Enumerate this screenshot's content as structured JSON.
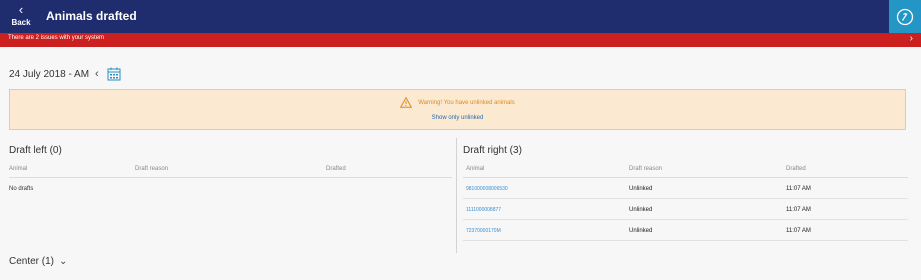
{
  "header": {
    "back_label": "Back",
    "back_icon": "‹",
    "title": "Animals drafted",
    "help_icon": "help-icon"
  },
  "issues": {
    "text": "There are 2 issues with your system",
    "arrow": "›"
  },
  "date": {
    "value": "24 July 2018 - AM",
    "prev_icon": "‹"
  },
  "warning": {
    "text": "Warning! You have unlinked animals",
    "link": "Show only unlinked"
  },
  "draft_left": {
    "title": "Draft left (0)",
    "columns": [
      "Animal",
      "Draft reason",
      "Drafted"
    ],
    "empty": "No drafts"
  },
  "draft_right": {
    "title": "Draft right (3)",
    "columns": [
      "Animal",
      "Draft reason",
      "Drafted"
    ],
    "rows": [
      {
        "animal": "981000008006530",
        "reason": "Unlinked",
        "drafted": "11:07 AM"
      },
      {
        "animal": "1111000008877",
        "reason": "Unlinked",
        "drafted": "11:07 AM"
      },
      {
        "animal": "72370000170M",
        "reason": "Unlinked",
        "drafted": "11:07 AM"
      }
    ]
  },
  "center": {
    "label": "Center (1)",
    "chevron": "⌄"
  },
  "colors": {
    "header_bg": "#1f2d6e",
    "issues_bg": "#cc1f1f",
    "accent": "#2496c6",
    "warning_bg": "#fbe9d2",
    "warning_text": "#e08a1e",
    "link": "#3a8fd1"
  }
}
